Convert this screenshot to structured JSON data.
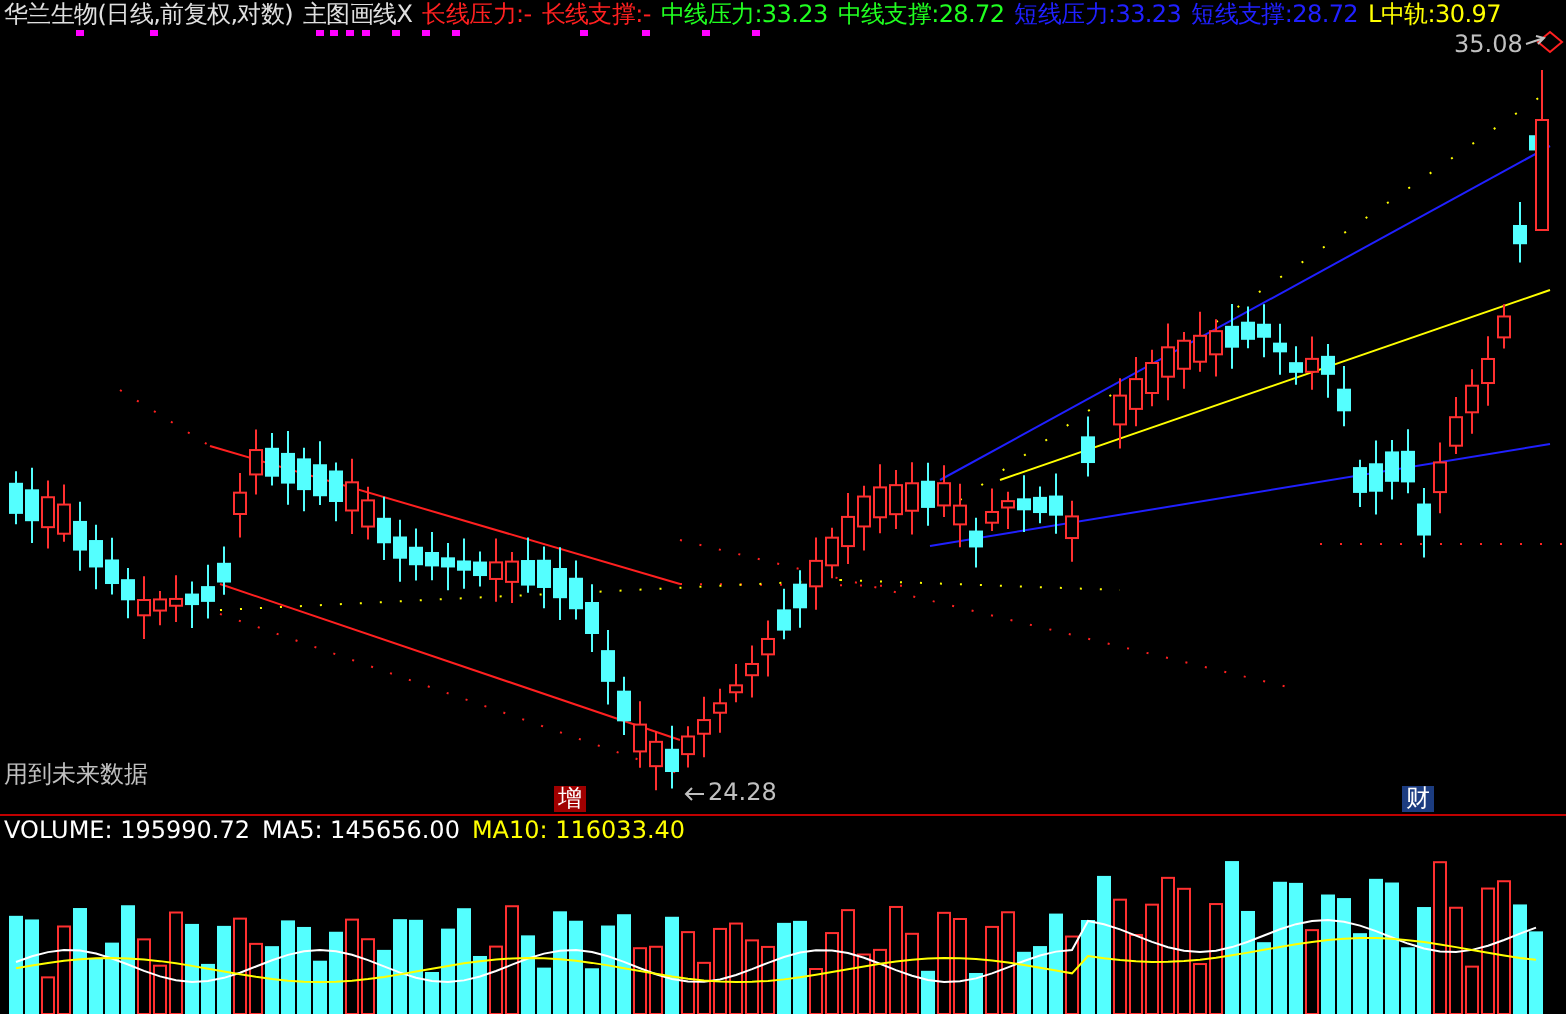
{
  "header": {
    "title": "华兰生物(日线,前复权,对数)",
    "indicator": "主图画线X",
    "values": [
      {
        "label": "长线压力:",
        "value": "-",
        "color": "#ff2020"
      },
      {
        "label": "长线支撑:",
        "value": "-",
        "color": "#ff2020"
      },
      {
        "label": "中线压力:",
        "value": "33.23",
        "color": "#20ff20"
      },
      {
        "label": "中线支撑:",
        "value": "28.72",
        "color": "#20ff20"
      },
      {
        "label": "短线压力:",
        "value": "33.23",
        "color": "#2020ff"
      },
      {
        "label": "短线支撑:",
        "value": "28.72",
        "color": "#2020ff"
      },
      {
        "label": "L中轨:",
        "value": "30.97",
        "color": "#ffff00"
      }
    ]
  },
  "main_chart": {
    "high_label": "35.08",
    "low_label": "24.28",
    "warning": "用到未来数据",
    "markers": [
      {
        "text": "增",
        "color": "#a00000"
      },
      {
        "text": "财",
        "color": "#1c3c80"
      }
    ]
  },
  "volume_panel": {
    "values": [
      {
        "label": "VOLUME:",
        "value": "195990.72",
        "color": "#ffffff"
      },
      {
        "label": "MA5:",
        "value": "145656.00",
        "color": "#ffffff"
      },
      {
        "label": "MA10:",
        "value": "116033.40",
        "color": "#ffff00"
      }
    ]
  }
}
